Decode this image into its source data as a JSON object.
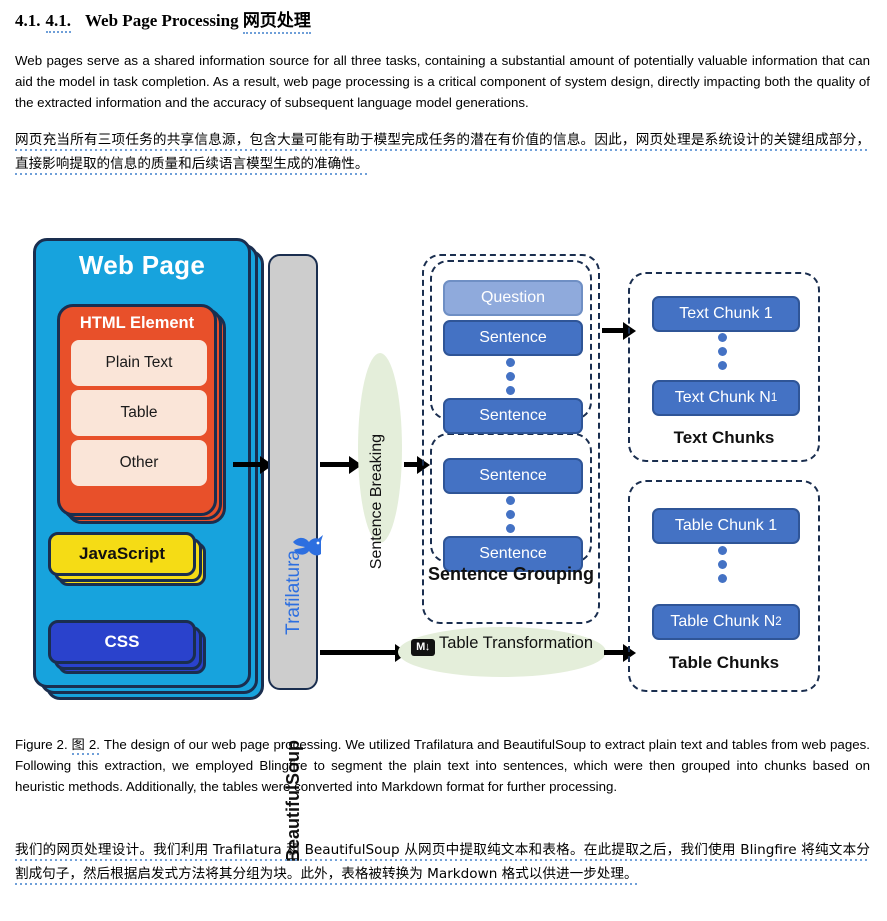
{
  "heading": {
    "number_original": "4.1.",
    "number_translated": "4.1.",
    "title_en": "Web Page Processing",
    "title_cn": "网页处理"
  },
  "body": {
    "paragraph_en": "Web pages serve as a shared information source for all three tasks, containing a substantial amount of potentially valuable information that can aid the model in task completion. As a result, web page processing is a critical component of system design, directly impacting both the quality of the extracted information and the accuracy of subsequent language model generations.",
    "paragraph_cn": "网页充当所有三项任务的共享信息源，包含大量可能有助于模型完成任务的潜在有价值的信息。因此，网页处理是系统设计的关键组成部分，直接影响提取的信息的质量和后续语言模型生成的准确性。"
  },
  "figure": {
    "web_page": {
      "title": "Web Page",
      "html_element": {
        "title": "HTML Element",
        "items": [
          "Plain Text",
          "Table",
          "Other"
        ]
      },
      "javascript": "JavaScript",
      "css": "CSS"
    },
    "extractor": {
      "trafilatura": "Trafilatura",
      "beautifulsoup": "BeautifulSoup"
    },
    "sentence_breaking": "Sentence Breaking",
    "table_transformation": {
      "badge": "M↓",
      "label": "Table Transformation"
    },
    "sentence_grouping": {
      "label": "Sentence Grouping",
      "group1": [
        "Question",
        "Sentence",
        "Sentence"
      ],
      "group2": [
        "Sentence",
        "Sentence"
      ]
    },
    "text_chunks": {
      "label": "Text Chunks",
      "first": "Text Chunk 1",
      "last_prefix": "Text Chunk N",
      "last_sub": "1"
    },
    "table_chunks": {
      "label": "Table Chunks",
      "first": "Table Chunk 1",
      "last_prefix": "Table Chunk N",
      "last_sub": "2"
    },
    "colors": {
      "web_page_bg": "#17a3dd",
      "html_element_bg": "#e8502a",
      "html_item_bg": "#fae5d8",
      "javascript_bg": "#f5dc15",
      "css_bg": "#2a42cc",
      "extractor_bg": "#cdcdcd",
      "ellipse_bg": "#e4eeda",
      "chunk_bg": "#4472c4",
      "question_bg": "#8faadc",
      "border": "#1a2e4f",
      "trafilatura_text": "#2d6fe0",
      "underline": "#6f9fd8"
    }
  },
  "caption": {
    "figure_label_en": "Figure 2.",
    "figure_label_cn": "图 2.",
    "text_en": "The design of our web page processing. We utilized Trafilatura and BeautifulSoup to extract plain text and tables from web pages. Following this extraction, we employed Blingfire to segment the plain text into sentences, which were then grouped into chunks based on heuristic methods. Additionally, the tables were converted into Markdown format for further processing.",
    "text_cn": "我们的网页处理设计。我们利用 Trafilatura 和 BeautifulSoup 从网页中提取纯文本和表格。在此提取之后，我们使用 Blingfire 将纯文本分割成句子，然后根据启发式方法将其分组为块。此外，表格被转换为 Markdown 格式以供进一步处理。"
  }
}
